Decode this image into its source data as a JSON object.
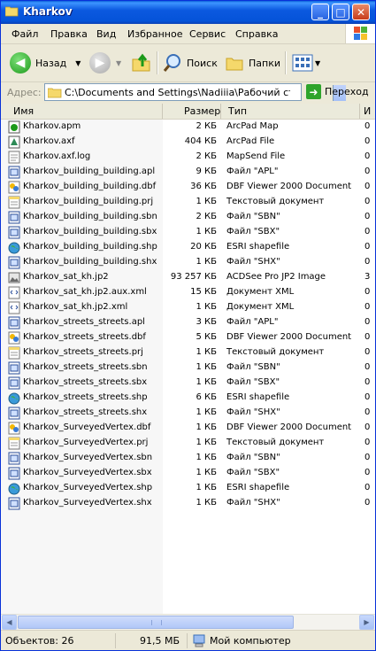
{
  "window": {
    "title": "Kharkov",
    "min_label": "_",
    "max_label": "□",
    "close_label": "✕"
  },
  "menu": [
    "Файл",
    "Правка",
    "Вид",
    "Избранное",
    "Сервис",
    "Справка"
  ],
  "toolbar": {
    "back_label": "Назад",
    "search_label": "Поиск",
    "folders_label": "Папки"
  },
  "address": {
    "label": "Адрес:",
    "path": "C:\\Documents and Settings\\Nadiiia\\Рабочий стол\\[D",
    "go_label": "Переход"
  },
  "columns": {
    "name": "Имя",
    "size": "Размер",
    "type": "Тип",
    "date": "И"
  },
  "files": [
    {
      "name": "Kharkov.apm",
      "size": "2 КБ",
      "type": "ArcPad Map",
      "date": "0",
      "icon": "arcpad-map-icon"
    },
    {
      "name": "Kharkov.axf",
      "size": "404 КБ",
      "type": "ArcPad File",
      "date": "0",
      "icon": "arcpad-file-icon"
    },
    {
      "name": "Kharkov.axf.log",
      "size": "2 КБ",
      "type": "MapSend File",
      "date": "0",
      "icon": "doc-icon"
    },
    {
      "name": "Kharkov_building_building.apl",
      "size": "9 КБ",
      "type": "Файл \"APL\"",
      "date": "0",
      "icon": "generic-file-icon"
    },
    {
      "name": "Kharkov_building_building.dbf",
      "size": "36 КБ",
      "type": "DBF Viewer 2000 Document",
      "date": "0",
      "icon": "dbf-icon"
    },
    {
      "name": "Kharkov_building_building.prj",
      "size": "1 КБ",
      "type": "Текстовый документ",
      "date": "0",
      "icon": "text-doc-icon"
    },
    {
      "name": "Kharkov_building_building.sbn",
      "size": "2 КБ",
      "type": "Файл \"SBN\"",
      "date": "0",
      "icon": "generic-file-icon"
    },
    {
      "name": "Kharkov_building_building.sbx",
      "size": "1 КБ",
      "type": "Файл \"SBX\"",
      "date": "0",
      "icon": "generic-file-icon"
    },
    {
      "name": "Kharkov_building_building.shp",
      "size": "20 КБ",
      "type": "ESRI shapefile",
      "date": "0",
      "icon": "globe-icon"
    },
    {
      "name": "Kharkov_building_building.shx",
      "size": "1 КБ",
      "type": "Файл \"SHX\"",
      "date": "0",
      "icon": "generic-file-icon"
    },
    {
      "name": "Kharkov_sat_kh.jp2",
      "size": "93 257 КБ",
      "type": "ACDSee Pro JP2 Image",
      "date": "3",
      "icon": "image-icon"
    },
    {
      "name": "Kharkov_sat_kh.jp2.aux.xml",
      "size": "15 КБ",
      "type": "Документ XML",
      "date": "0",
      "icon": "xml-icon"
    },
    {
      "name": "Kharkov_sat_kh.jp2.xml",
      "size": "1 КБ",
      "type": "Документ XML",
      "date": "0",
      "icon": "xml-icon"
    },
    {
      "name": "Kharkov_streets_streets.apl",
      "size": "3 КБ",
      "type": "Файл \"APL\"",
      "date": "0",
      "icon": "generic-file-icon"
    },
    {
      "name": "Kharkov_streets_streets.dbf",
      "size": "5 КБ",
      "type": "DBF Viewer 2000 Document",
      "date": "0",
      "icon": "dbf-icon"
    },
    {
      "name": "Kharkov_streets_streets.prj",
      "size": "1 КБ",
      "type": "Текстовый документ",
      "date": "0",
      "icon": "text-doc-icon"
    },
    {
      "name": "Kharkov_streets_streets.sbn",
      "size": "1 КБ",
      "type": "Файл \"SBN\"",
      "date": "0",
      "icon": "generic-file-icon"
    },
    {
      "name": "Kharkov_streets_streets.sbx",
      "size": "1 КБ",
      "type": "Файл \"SBX\"",
      "date": "0",
      "icon": "generic-file-icon"
    },
    {
      "name": "Kharkov_streets_streets.shp",
      "size": "6 КБ",
      "type": "ESRI shapefile",
      "date": "0",
      "icon": "globe-icon"
    },
    {
      "name": "Kharkov_streets_streets.shx",
      "size": "1 КБ",
      "type": "Файл \"SHX\"",
      "date": "0",
      "icon": "generic-file-icon"
    },
    {
      "name": "Kharkov_SurveyedVertex.dbf",
      "size": "1 КБ",
      "type": "DBF Viewer 2000 Document",
      "date": "0",
      "icon": "dbf-icon"
    },
    {
      "name": "Kharkov_SurveyedVertex.prj",
      "size": "1 КБ",
      "type": "Текстовый документ",
      "date": "0",
      "icon": "text-doc-icon"
    },
    {
      "name": "Kharkov_SurveyedVertex.sbn",
      "size": "1 КБ",
      "type": "Файл \"SBN\"",
      "date": "0",
      "icon": "generic-file-icon"
    },
    {
      "name": "Kharkov_SurveyedVertex.sbx",
      "size": "1 КБ",
      "type": "Файл \"SBX\"",
      "date": "0",
      "icon": "generic-file-icon"
    },
    {
      "name": "Kharkov_SurveyedVertex.shp",
      "size": "1 КБ",
      "type": "ESRI shapefile",
      "date": "0",
      "icon": "globe-icon"
    },
    {
      "name": "Kharkov_SurveyedVertex.shx",
      "size": "1 КБ",
      "type": "Файл \"SHX\"",
      "date": "0",
      "icon": "generic-file-icon"
    }
  ],
  "status": {
    "objects": "Объектов: 26",
    "size": "91,5 МБ",
    "location": "Мой компьютер"
  },
  "colors": {
    "titlebar": "#0453d8",
    "window_bg": "#ece9d8",
    "list_bg": "#ffffff"
  }
}
